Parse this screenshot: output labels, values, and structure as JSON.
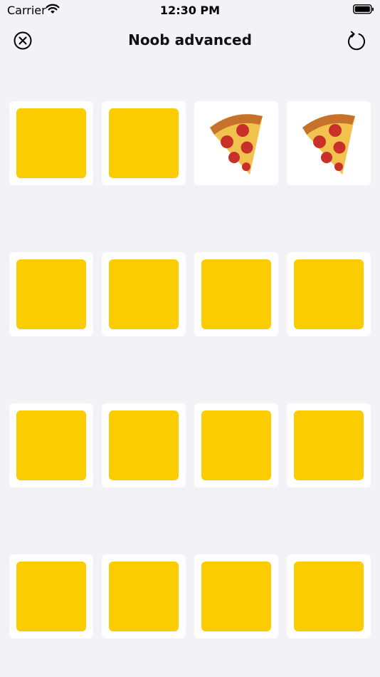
{
  "status_bar": {
    "carrier": "Carrier",
    "time": "12:30 PM"
  },
  "header": {
    "title": "Noob advanced",
    "close_icon": "close-circle-icon",
    "restart_icon": "restart-icon"
  },
  "colors": {
    "background": "#f2f2f7",
    "card_face": "#ffffff",
    "card_back": "#fbcc00"
  },
  "board": {
    "rows": 4,
    "columns": 4,
    "cards": [
      {
        "state": "hidden"
      },
      {
        "state": "hidden"
      },
      {
        "state": "revealed",
        "symbol": "pizza-icon"
      },
      {
        "state": "revealed",
        "symbol": "pizza-icon"
      },
      {
        "state": "hidden"
      },
      {
        "state": "hidden"
      },
      {
        "state": "hidden"
      },
      {
        "state": "hidden"
      },
      {
        "state": "hidden"
      },
      {
        "state": "hidden"
      },
      {
        "state": "hidden"
      },
      {
        "state": "hidden"
      },
      {
        "state": "hidden"
      },
      {
        "state": "hidden"
      },
      {
        "state": "hidden"
      },
      {
        "state": "hidden"
      }
    ]
  }
}
